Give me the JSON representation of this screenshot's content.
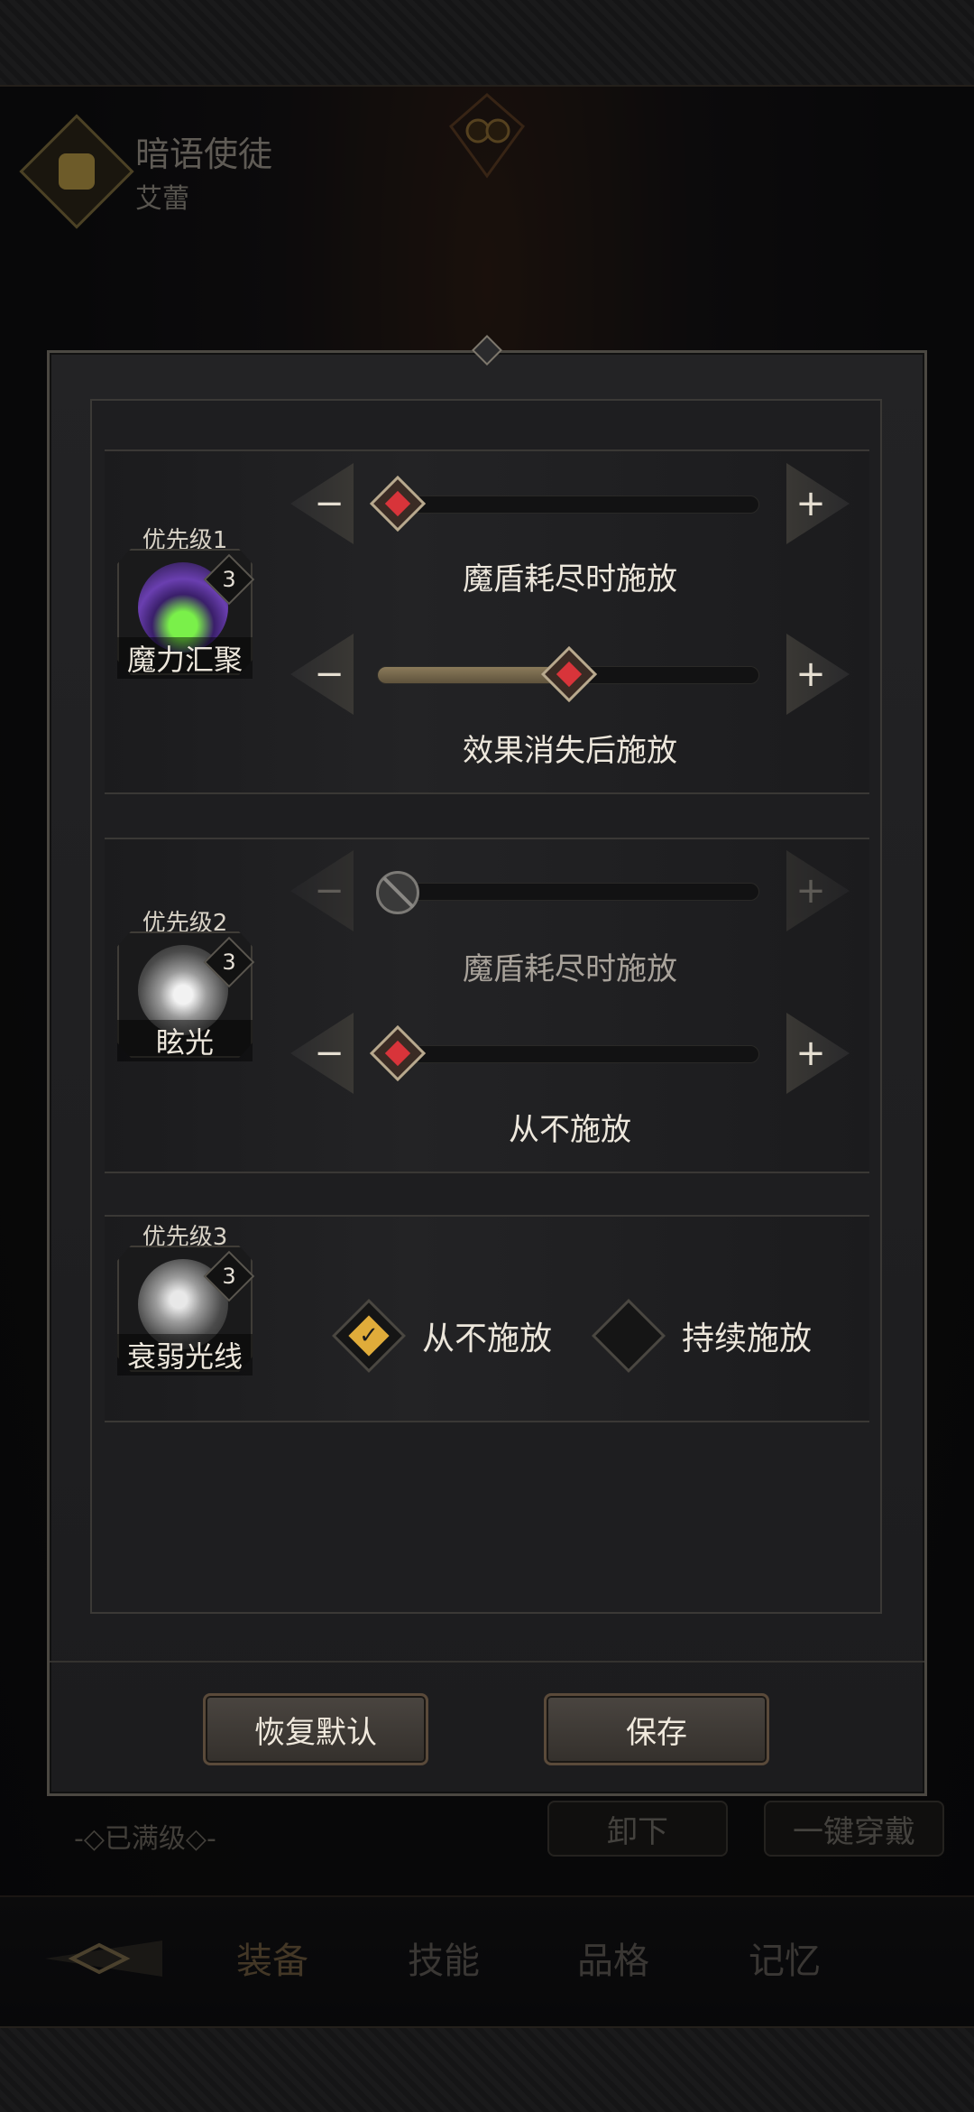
{
  "hero": {
    "title": "暗语使徒",
    "subtitle": "艾蕾"
  },
  "behind": {
    "max_level": "-◇已满级◇-",
    "unequip_label": "卸下",
    "one_click_equip_label": "一键穿戴",
    "bottom_tabs": [
      "装备",
      "技能",
      "品格",
      "记忆"
    ]
  },
  "dialog": {
    "skills": [
      {
        "priority": "优先级1",
        "name": "魔力汇聚",
        "level": "3",
        "sliders": [
          {
            "caption": "魔盾耗尽时施放",
            "value": 0,
            "enabled": true
          },
          {
            "caption": "效果消失后施放",
            "value": 0.5,
            "enabled": true
          }
        ]
      },
      {
        "priority": "优先级2",
        "name": "眩光",
        "level": "3",
        "sliders": [
          {
            "caption": "魔盾耗尽时施放",
            "value": 0,
            "enabled": false
          },
          {
            "caption": "从不施放",
            "value": 0,
            "enabled": true
          }
        ]
      },
      {
        "priority": "优先级3",
        "name": "衰弱光线",
        "level": "3",
        "options": [
          {
            "label": "从不施放",
            "selected": true
          },
          {
            "label": "持续施放",
            "selected": false
          }
        ]
      }
    ],
    "buttons": {
      "reset": "恢复默认",
      "save": "保存"
    }
  },
  "icons": {
    "minus": "−",
    "plus": "+",
    "check": "✓"
  },
  "colors": {
    "accent_gold": "#e0ac3a",
    "thumb_red": "#d8343a"
  }
}
